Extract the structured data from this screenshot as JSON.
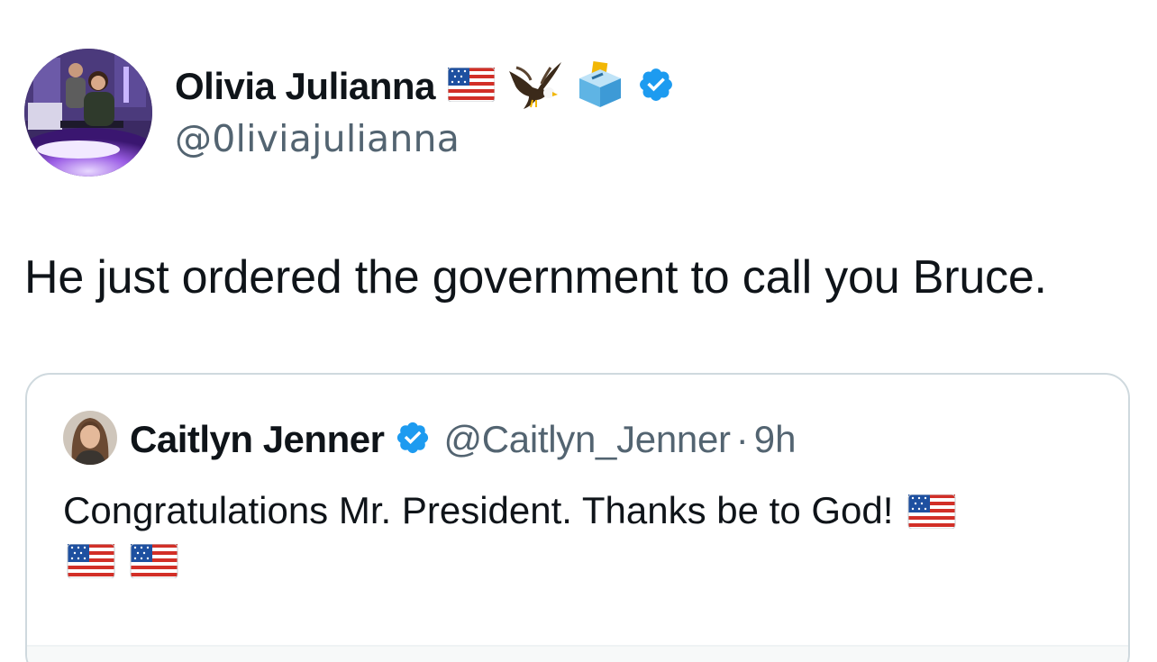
{
  "tweet": {
    "author": {
      "display_name": "Olivia Julianna",
      "handle": "@0liviajulianna",
      "badges": [
        "us-flag-icon",
        "eagle-icon",
        "ballot-box-icon",
        "verified-badge-icon"
      ]
    },
    "text": "He just ordered the government to call you Bruce."
  },
  "quoted_tweet": {
    "author": {
      "display_name": "Caitlyn Jenner",
      "handle": "@Caitlyn_Jenner",
      "separator": "·",
      "time": "9h",
      "badges": [
        "verified-badge-icon"
      ]
    },
    "text": "Congratulations Mr. President. Thanks be to God!",
    "trailing_emoji": [
      "us-flag-icon",
      "us-flag-icon",
      "us-flag-icon"
    ]
  },
  "colors": {
    "text_primary": "#0f1419",
    "text_secondary": "#536471",
    "verified_blue": "#1d9bf0",
    "card_border": "#cfd9de"
  }
}
